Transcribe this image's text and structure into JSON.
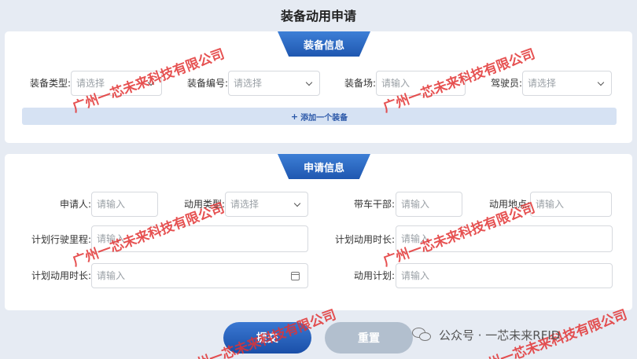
{
  "page": {
    "title": "装备动用申请"
  },
  "equipment_section": {
    "title": "装备信息",
    "fields": {
      "equipment_type": {
        "label": "装备类型:",
        "placeholder": "请选择"
      },
      "equipment_number": {
        "label": "装备编号:",
        "placeholder": "请选择"
      },
      "equipment_site": {
        "label": "装备场:",
        "placeholder": "请输入"
      },
      "driver": {
        "label": "驾驶员:",
        "placeholder": "请选择"
      }
    },
    "add_button": {
      "icon": "plus-icon",
      "plus": "+",
      "label": "添加一个装备"
    }
  },
  "application_section": {
    "title": "申请信息",
    "fields": {
      "applicant": {
        "label": "申请人:",
        "placeholder": "请输入"
      },
      "usage_type": {
        "label": "动用类型:",
        "placeholder": "请选择"
      },
      "escort_officer": {
        "label": "带车干部:",
        "placeholder": "请输入"
      },
      "usage_location": {
        "label": "动用地点:",
        "placeholder": "请输入"
      },
      "planned_mileage": {
        "label": "计划行驶里程:",
        "placeholder": "请输入"
      },
      "planned_duration_a": {
        "label": "计划动用时长:",
        "placeholder": "请输入"
      },
      "planned_duration_b": {
        "label": "计划动用时长:",
        "placeholder": "请输入"
      },
      "usage_plan": {
        "label": "动用计划:",
        "placeholder": "请输入"
      }
    }
  },
  "actions": {
    "submit": "提交",
    "reset": "重置"
  },
  "watermark": {
    "text": "广州一芯未来科技有限公司",
    "color": "#e23232"
  },
  "credit": {
    "icon": "wechat-icon",
    "text": "公众号 · 一芯未来RFID"
  },
  "colors": {
    "accent": "#1f57b0",
    "background": "#e6ebf3",
    "add_bar": "#d6e2f3",
    "reset": "#b2bfce"
  }
}
